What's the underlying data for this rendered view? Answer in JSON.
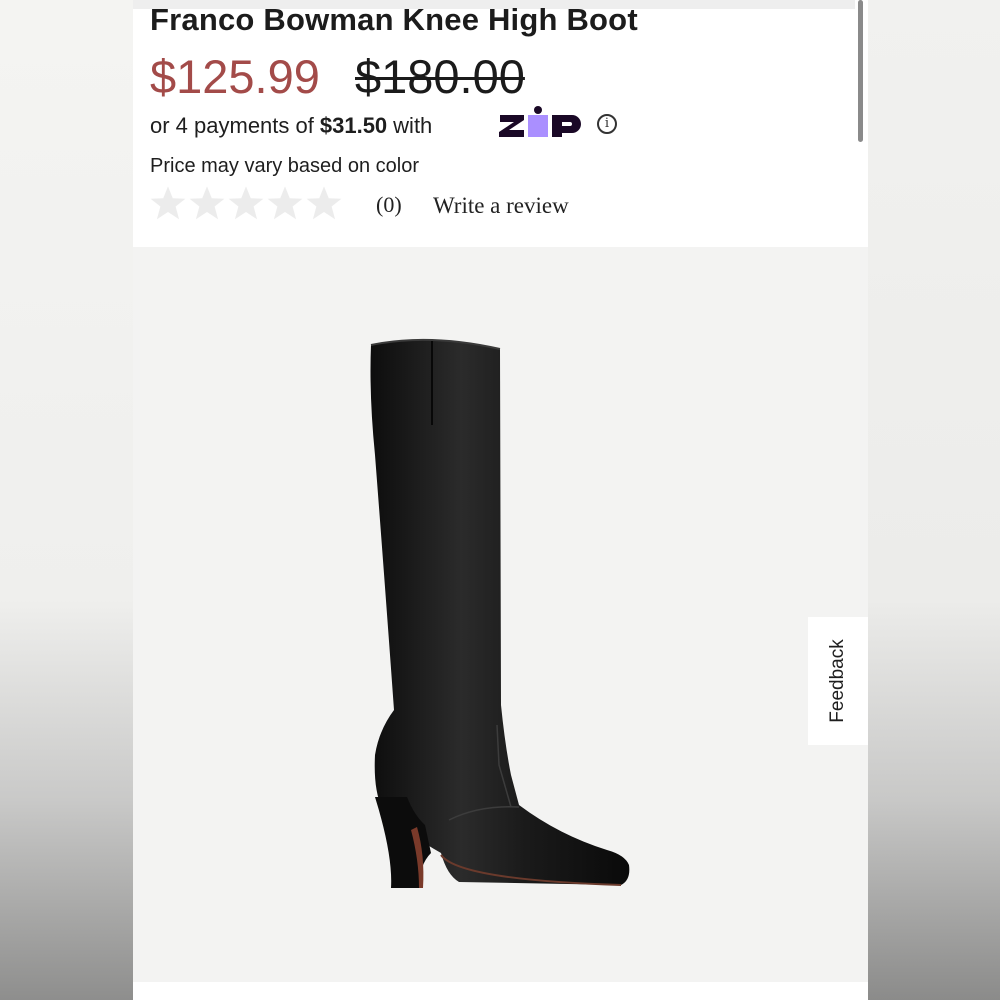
{
  "product": {
    "title": "Franco Bowman Knee High Boot",
    "sale_price": "$125.99",
    "original_price": "$180.00",
    "price_note": "Price may vary based on color"
  },
  "installments": {
    "prefix": "or 4 payments of",
    "amount": "$31.50",
    "suffix": "with",
    "provider_logo": "Zip",
    "info_icon": "info-icon"
  },
  "reviews": {
    "rating_stars": 0,
    "max_stars": 5,
    "count": "(0)",
    "write_link": "Write a review"
  },
  "feedback_tab": {
    "label": "Feedback"
  },
  "colors": {
    "sale_price": "#a34b49",
    "zip_dark": "#1a0826",
    "zip_purple": "#aa8fff",
    "star_empty": "#ececec",
    "image_background": "#f3f3f2"
  }
}
